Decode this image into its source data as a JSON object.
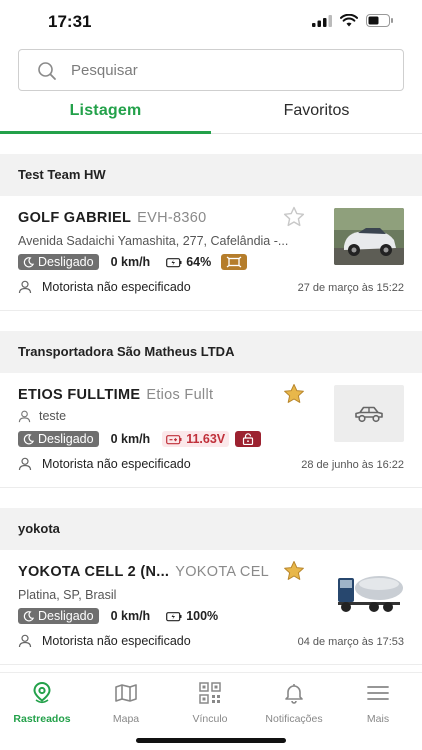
{
  "status_bar": {
    "time": "17:31"
  },
  "search": {
    "placeholder": "Pesquisar",
    "value": ""
  },
  "tabs": [
    {
      "label": "Listagem",
      "active": true
    },
    {
      "label": "Favoritos",
      "active": false
    }
  ],
  "groups": [
    {
      "name": "Test Team HW",
      "vehicles": [
        {
          "name": "GOLF GABRIEL",
          "plate": "EVH-8360",
          "address": "Avenida Sadaichi Yamashita, 277, Cafelândia -...",
          "status": "Desligado",
          "speed": "0 km/h",
          "battery": "64%",
          "driver": "Motorista não especificado",
          "timestamp": "27 de março às 15:22",
          "favorite": false,
          "thumbnail": "car-photo"
        }
      ]
    },
    {
      "name": "Transportadora São Matheus LTDA",
      "vehicles": [
        {
          "name": "ETIOS FULLTIME",
          "plate": "Etios Fullt",
          "user": "teste",
          "status": "Desligado",
          "speed": "0 km/h",
          "battery": "11.63V",
          "driver": "Motorista não especificado",
          "timestamp": "28 de junho às 16:22",
          "favorite": true,
          "thumbnail": "car-icon-placeholder"
        }
      ]
    },
    {
      "name": "yokota",
      "vehicles": [
        {
          "name": "YOKOTA CELL 2 (N...",
          "plate": "YOKOTA CEL",
          "address": "Platina, SP, Brasil",
          "status": "Desligado",
          "speed": "0 km/h",
          "battery": "100%",
          "driver": "Motorista não especificado",
          "timestamp": "04 de março às 17:53",
          "favorite": true,
          "thumbnail": "truck-photo"
        }
      ]
    }
  ],
  "bottom_nav": [
    {
      "label": "Rastreados",
      "icon": "location-pin-icon",
      "active": true
    },
    {
      "label": "Mapa",
      "icon": "map-icon",
      "active": false
    },
    {
      "label": "Vínculo",
      "icon": "qr-code-icon",
      "active": false
    },
    {
      "label": "Notificações",
      "icon": "bell-icon",
      "active": false
    },
    {
      "label": "Mais",
      "icon": "menu-icon",
      "active": false
    }
  ],
  "colors": {
    "accent": "#23a14a",
    "star_filled": "#e8b74a",
    "alert": "#c0303a",
    "status_badge": "#6f6f6f"
  }
}
